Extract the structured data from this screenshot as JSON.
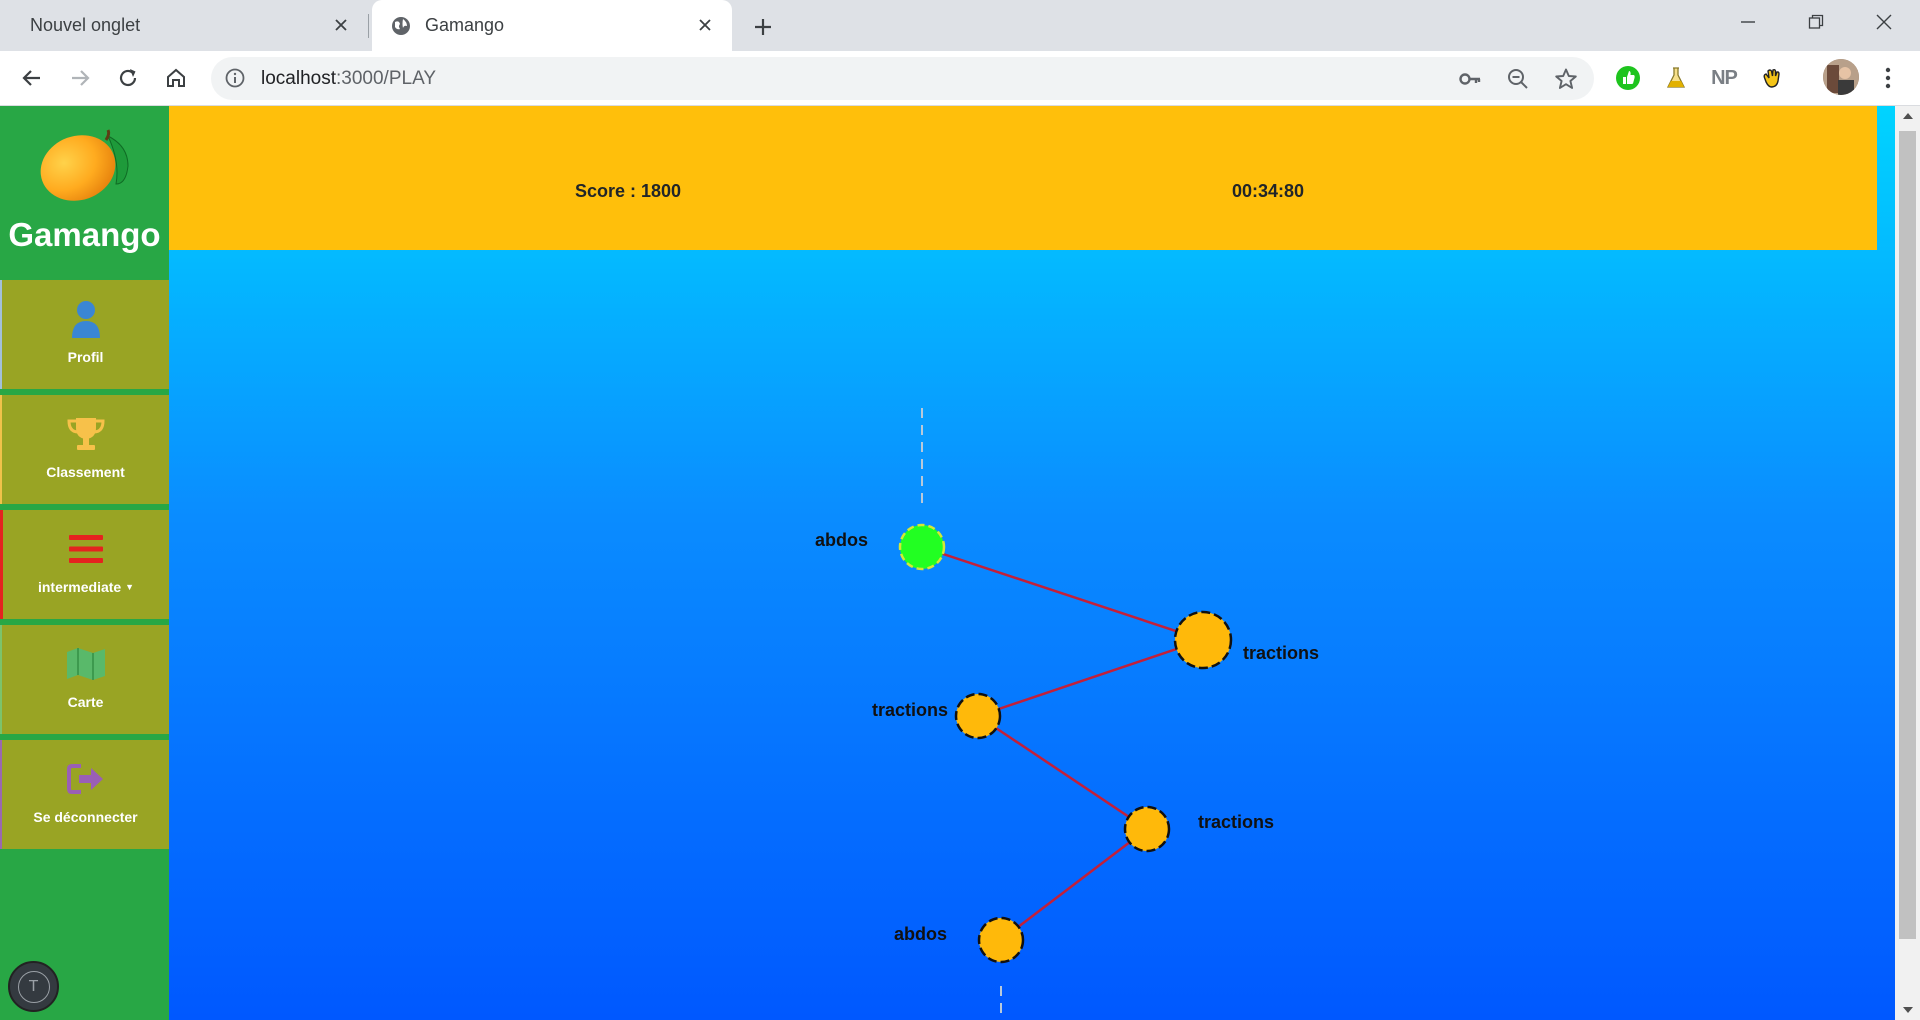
{
  "browser": {
    "tabs": [
      {
        "title": "Nouvel onglet",
        "active": false
      },
      {
        "title": "Gamango",
        "active": true
      }
    ],
    "address": {
      "host": "localhost",
      "path": ":3000/PLAY"
    },
    "extensions": [
      "thumbs-up-extension",
      "flask-extension",
      "NP",
      "hand-extension"
    ],
    "icons": {
      "back": "back-arrow-icon",
      "forward": "forward-arrow-icon",
      "reload": "reload-icon",
      "home": "home-icon",
      "key": "key-icon",
      "zoom": "zoom-out-icon",
      "star": "star-icon",
      "menu": "kebab-menu-icon"
    }
  },
  "app": {
    "name": "Gamango",
    "colors": {
      "sidebar": "#28a745",
      "menu_item": "#99a424",
      "header": "#ffbf0b",
      "node": "#ffb90a",
      "node_done": "#22ff22",
      "path": "#c2203a"
    }
  },
  "sidebar": {
    "items": [
      {
        "label": "Profil",
        "icon": "user-icon"
      },
      {
        "label": "Classement",
        "icon": "trophy-icon"
      },
      {
        "label": "intermediate",
        "icon": "bars-icon",
        "dropdown": true
      },
      {
        "label": "Carte",
        "icon": "map-icon"
      },
      {
        "label": "Se déconnecter",
        "icon": "sign-out-icon"
      }
    ],
    "bottom_button": "T"
  },
  "header": {
    "score": "Score : 1800",
    "timer": "00:34:80"
  },
  "path": {
    "nodes": [
      {
        "label": "abdos",
        "status": "done"
      },
      {
        "label": "tractions",
        "status": "locked"
      },
      {
        "label": "tractions",
        "status": "locked"
      },
      {
        "label": "tractions",
        "status": "locked"
      },
      {
        "label": "abdos",
        "status": "locked"
      }
    ]
  }
}
